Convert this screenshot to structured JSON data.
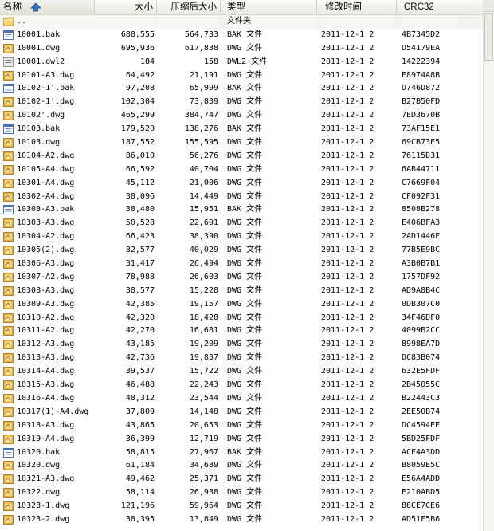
{
  "columns": {
    "name": "名称",
    "size": "大小",
    "compressed": "压缩后大小",
    "type": "类型",
    "modified": "修改时间",
    "crc": "CRC32"
  },
  "icons": {
    "sort": "sort-ascending-arrow-icon",
    "folder": "folder-icon",
    "bak": "bak-file-icon",
    "dwg": "dwg-file-icon",
    "dwl2": "dwl2-file-icon"
  },
  "colors": {
    "folder": "#f3d26a",
    "dwg": "#e8b03a",
    "bak": "#4b6fb5",
    "sort_arrow": "#2f6fc4"
  },
  "rows": [
    {
      "icon": "folder",
      "name": "..",
      "size": "",
      "compressed": "",
      "type": "文件夹",
      "modified": "",
      "crc": "",
      "selected": true
    },
    {
      "icon": "bak",
      "name": "10001.bak",
      "size": "688,555",
      "compressed": "564,733",
      "type": "BAK 文件",
      "modified": "2011-12-1 2",
      "crc": "4B7345D2"
    },
    {
      "icon": "dwg",
      "name": "10001.dwg",
      "size": "695,936",
      "compressed": "617,838",
      "type": "DWG 文件",
      "modified": "2011-12-1 2",
      "crc": "D54179EA"
    },
    {
      "icon": "dwl2",
      "name": "10001.dwl2",
      "size": "184",
      "compressed": "158",
      "type": "DWL2 文件",
      "modified": "2011-12-1 2",
      "crc": "14222394"
    },
    {
      "icon": "dwg",
      "name": "10101-A3.dwg",
      "size": "64,492",
      "compressed": "21,191",
      "type": "DWG 文件",
      "modified": "2011-12-1 2",
      "crc": "E8974A8B"
    },
    {
      "icon": "bak",
      "name": "10102-1'.bak",
      "size": "97,208",
      "compressed": "65,999",
      "type": "BAK 文件",
      "modified": "2011-12-1 2",
      "crc": "D746D872"
    },
    {
      "icon": "dwg",
      "name": "10102-1'.dwg",
      "size": "102,304",
      "compressed": "73,839",
      "type": "DWG 文件",
      "modified": "2011-12-1 2",
      "crc": "B27B50FD"
    },
    {
      "icon": "dwg",
      "name": "10102'.dwg",
      "size": "465,299",
      "compressed": "384,747",
      "type": "DWG 文件",
      "modified": "2011-12-1 2",
      "crc": "7ED3670B"
    },
    {
      "icon": "bak",
      "name": "10103.bak",
      "size": "179,520",
      "compressed": "138,276",
      "type": "BAK 文件",
      "modified": "2011-12-1 2",
      "crc": "73AF15E1"
    },
    {
      "icon": "dwg",
      "name": "10103.dwg",
      "size": "187,552",
      "compressed": "155,595",
      "type": "DWG 文件",
      "modified": "2011-12-1 2",
      "crc": "69CB73E5"
    },
    {
      "icon": "dwg",
      "name": "10104-A2.dwg",
      "size": "86,010",
      "compressed": "56,276",
      "type": "DWG 文件",
      "modified": "2011-12-1 2",
      "crc": "76115D31"
    },
    {
      "icon": "dwg",
      "name": "10105-A4.dwg",
      "size": "66,592",
      "compressed": "40,704",
      "type": "DWG 文件",
      "modified": "2011-12-1 2",
      "crc": "6AB44711"
    },
    {
      "icon": "dwg",
      "name": "10301-A4.dwg",
      "size": "45,112",
      "compressed": "21,006",
      "type": "DWG 文件",
      "modified": "2011-12-1 2",
      "crc": "C7669F04"
    },
    {
      "icon": "dwg",
      "name": "10302-A4.dwg",
      "size": "38,096",
      "compressed": "14,449",
      "type": "DWG 文件",
      "modified": "2011-12-1 2",
      "crc": "CF092F31"
    },
    {
      "icon": "bak",
      "name": "10303-A3.bak",
      "size": "38,480",
      "compressed": "15,951",
      "type": "BAK 文件",
      "modified": "2011-12-1 2",
      "crc": "8508B278"
    },
    {
      "icon": "dwg",
      "name": "10303-A3.dwg",
      "size": "50,528",
      "compressed": "22,691",
      "type": "DWG 文件",
      "modified": "2011-12-1 2",
      "crc": "E406BFA3"
    },
    {
      "icon": "dwg",
      "name": "10304-A2.dwg",
      "size": "66,423",
      "compressed": "38,390",
      "type": "DWG 文件",
      "modified": "2011-12-1 2",
      "crc": "2AD1446F"
    },
    {
      "icon": "dwg",
      "name": "10305(2).dwg",
      "size": "82,577",
      "compressed": "40,029",
      "type": "DWG 文件",
      "modified": "2011-12-1 2",
      "crc": "77B5E9BC"
    },
    {
      "icon": "dwg",
      "name": "10306-A3.dwg",
      "size": "31,417",
      "compressed": "26,494",
      "type": "DWG 文件",
      "modified": "2011-12-1 2",
      "crc": "A3B0B7B1"
    },
    {
      "icon": "dwg",
      "name": "10307-A2.dwg",
      "size": "78,988",
      "compressed": "26,603",
      "type": "DWG 文件",
      "modified": "2011-12-1 2",
      "crc": "1757DF92"
    },
    {
      "icon": "dwg",
      "name": "10308-A3.dwg",
      "size": "38,577",
      "compressed": "15,228",
      "type": "DWG 文件",
      "modified": "2011-12-1 2",
      "crc": "AD9A8B4C"
    },
    {
      "icon": "dwg",
      "name": "10309-A3.dwg",
      "size": "42,385",
      "compressed": "19,157",
      "type": "DWG 文件",
      "modified": "2011-12-1 2",
      "crc": "0DB307C0"
    },
    {
      "icon": "dwg",
      "name": "10310-A2.dwg",
      "size": "42,320",
      "compressed": "18,428",
      "type": "DWG 文件",
      "modified": "2011-12-1 2",
      "crc": "34F46DF0"
    },
    {
      "icon": "dwg",
      "name": "10311-A2.dwg",
      "size": "42,270",
      "compressed": "16,681",
      "type": "DWG 文件",
      "modified": "2011-12-1 2",
      "crc": "4099B2CC"
    },
    {
      "icon": "dwg",
      "name": "10312-A3.dwg",
      "size": "43,185",
      "compressed": "19,209",
      "type": "DWG 文件",
      "modified": "2011-12-1 2",
      "crc": "8998EA7D"
    },
    {
      "icon": "dwg",
      "name": "10313-A3.dwg",
      "size": "42,736",
      "compressed": "19,837",
      "type": "DWG 文件",
      "modified": "2011-12-1 2",
      "crc": "DC83B074"
    },
    {
      "icon": "dwg",
      "name": "10314-A4.dwg",
      "size": "39,537",
      "compressed": "15,722",
      "type": "DWG 文件",
      "modified": "2011-12-1 2",
      "crc": "632E5FDF"
    },
    {
      "icon": "dwg",
      "name": "10315-A3.dwg",
      "size": "46,488",
      "compressed": "22,243",
      "type": "DWG 文件",
      "modified": "2011-12-1 2",
      "crc": "2B45055C"
    },
    {
      "icon": "dwg",
      "name": "10316-A4.dwg",
      "size": "48,312",
      "compressed": "23,544",
      "type": "DWG 文件",
      "modified": "2011-12-1 2",
      "crc": "B22443C3"
    },
    {
      "icon": "dwg",
      "name": "10317(1)-A4.dwg",
      "size": "37,809",
      "compressed": "14,148",
      "type": "DWG 文件",
      "modified": "2011-12-1 2",
      "crc": "2EE50B74"
    },
    {
      "icon": "dwg",
      "name": "10318-A3.dwg",
      "size": "43,865",
      "compressed": "20,653",
      "type": "DWG 文件",
      "modified": "2011-12-1 2",
      "crc": "DC4594EE"
    },
    {
      "icon": "dwg",
      "name": "10319-A4.dwg",
      "size": "36,399",
      "compressed": "12,719",
      "type": "DWG 文件",
      "modified": "2011-12-1 2",
      "crc": "5BD25FDF"
    },
    {
      "icon": "bak",
      "name": "10320.bak",
      "size": "58,815",
      "compressed": "27,967",
      "type": "BAK 文件",
      "modified": "2011-12-1 2",
      "crc": "ACF4A3DD"
    },
    {
      "icon": "dwg",
      "name": "10320.dwg",
      "size": "61,184",
      "compressed": "34,689",
      "type": "DWG 文件",
      "modified": "2011-12-1 2",
      "crc": "B8059E5C"
    },
    {
      "icon": "dwg",
      "name": "10321-A3.dwg",
      "size": "49,462",
      "compressed": "25,371",
      "type": "DWG 文件",
      "modified": "2011-12-1 2",
      "crc": "E56A4ADD"
    },
    {
      "icon": "dwg",
      "name": "10322.dwg",
      "size": "58,114",
      "compressed": "26,938",
      "type": "DWG 文件",
      "modified": "2011-12-1 2",
      "crc": "E210ABD5"
    },
    {
      "icon": "dwg",
      "name": "10323-1.dwg",
      "size": "121,196",
      "compressed": "59,964",
      "type": "DWG 文件",
      "modified": "2011-12-1 2",
      "crc": "88CE7CE6"
    },
    {
      "icon": "dwg",
      "name": "10323-2.dwg",
      "size": "38,395",
      "compressed": "13,849",
      "type": "DWG 文件",
      "modified": "2011-12-1 2",
      "crc": "AD51F5B6"
    }
  ]
}
